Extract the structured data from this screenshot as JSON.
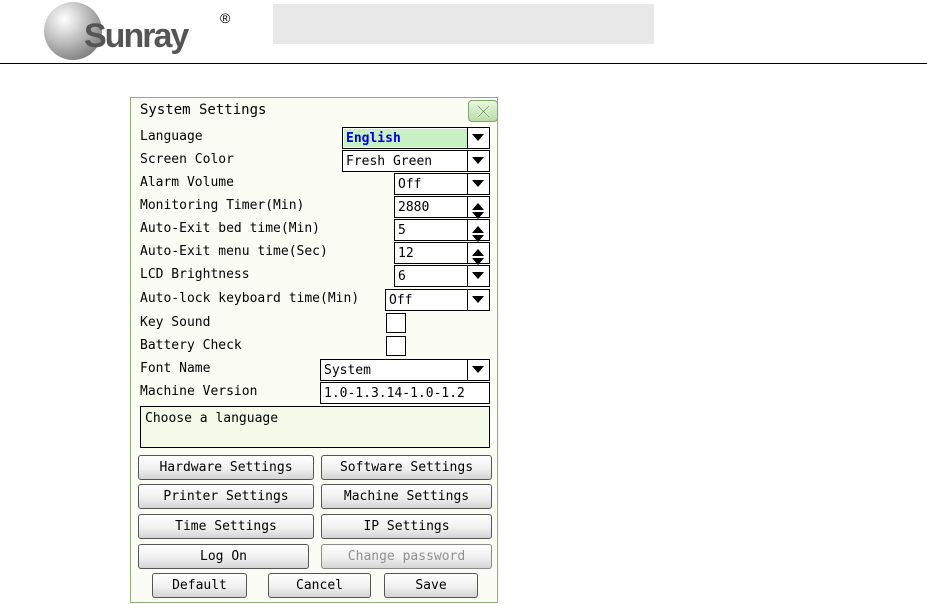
{
  "header": {
    "logo_text": "Sunray",
    "registered_mark": "®"
  },
  "dialog": {
    "title": "System Settings",
    "help_text": "Choose a language"
  },
  "settings": [
    {
      "label": "Language",
      "value": "English"
    },
    {
      "label": "Screen Color",
      "value": "Fresh Green"
    },
    {
      "label": "Alarm Volume",
      "value": "Off"
    },
    {
      "label": "Monitoring Timer(Min)",
      "value": "2880"
    },
    {
      "label": "Auto-Exit bed time(Min)",
      "value": "5"
    },
    {
      "label": "Auto-Exit menu time(Sec)",
      "value": "12"
    },
    {
      "label": "LCD Brightness",
      "value": "6"
    },
    {
      "label": "Auto-lock keyboard time(Min)",
      "value": "Off"
    },
    {
      "label": "Key Sound",
      "checked": false
    },
    {
      "label": "Battery Check",
      "checked": false
    },
    {
      "label": "Font Name",
      "value": "System"
    },
    {
      "label": "Machine Version",
      "value": "1.0-1.3.14-1.0-1.2"
    }
  ],
  "buttons": {
    "hardware": "Hardware Settings",
    "software": "Software Settings",
    "printer": "Printer Settings",
    "machine": "Machine Settings",
    "time": "Time Settings",
    "ip": "IP Settings",
    "logon": "Log On",
    "change_password": "Change password",
    "default": "Default",
    "cancel": "Cancel",
    "save": "Save"
  },
  "colors": {
    "accent_highlight": "#c7f0c3",
    "selected_text": "#0000e0",
    "dialog_border": "#8db07a"
  }
}
